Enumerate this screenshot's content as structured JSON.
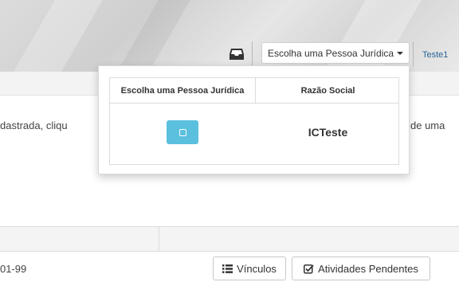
{
  "header": {
    "pj_dropdown_label": "Escolha uma Pessoa Jurídica",
    "user_name": "Teste1"
  },
  "body": {
    "text_left": "dastrada, cliqu",
    "text_right": "de uma"
  },
  "table": {
    "row_value": "01-99",
    "vinculos_label": "Vínculos",
    "atividades_label": "Atividades Pendentes"
  },
  "popup": {
    "col_pessoa": "Escolha uma Pessoa Jurídica",
    "col_razao": "Razão Social",
    "rows": [
      {
        "razao_social": "ICTeste"
      }
    ]
  },
  "icons": {
    "inbox": "inbox-icon",
    "list": "list-icon",
    "check": "check-square-icon",
    "select": "square-icon"
  },
  "colors": {
    "select_button": "#5bc0de",
    "user_link": "#2a6496"
  }
}
